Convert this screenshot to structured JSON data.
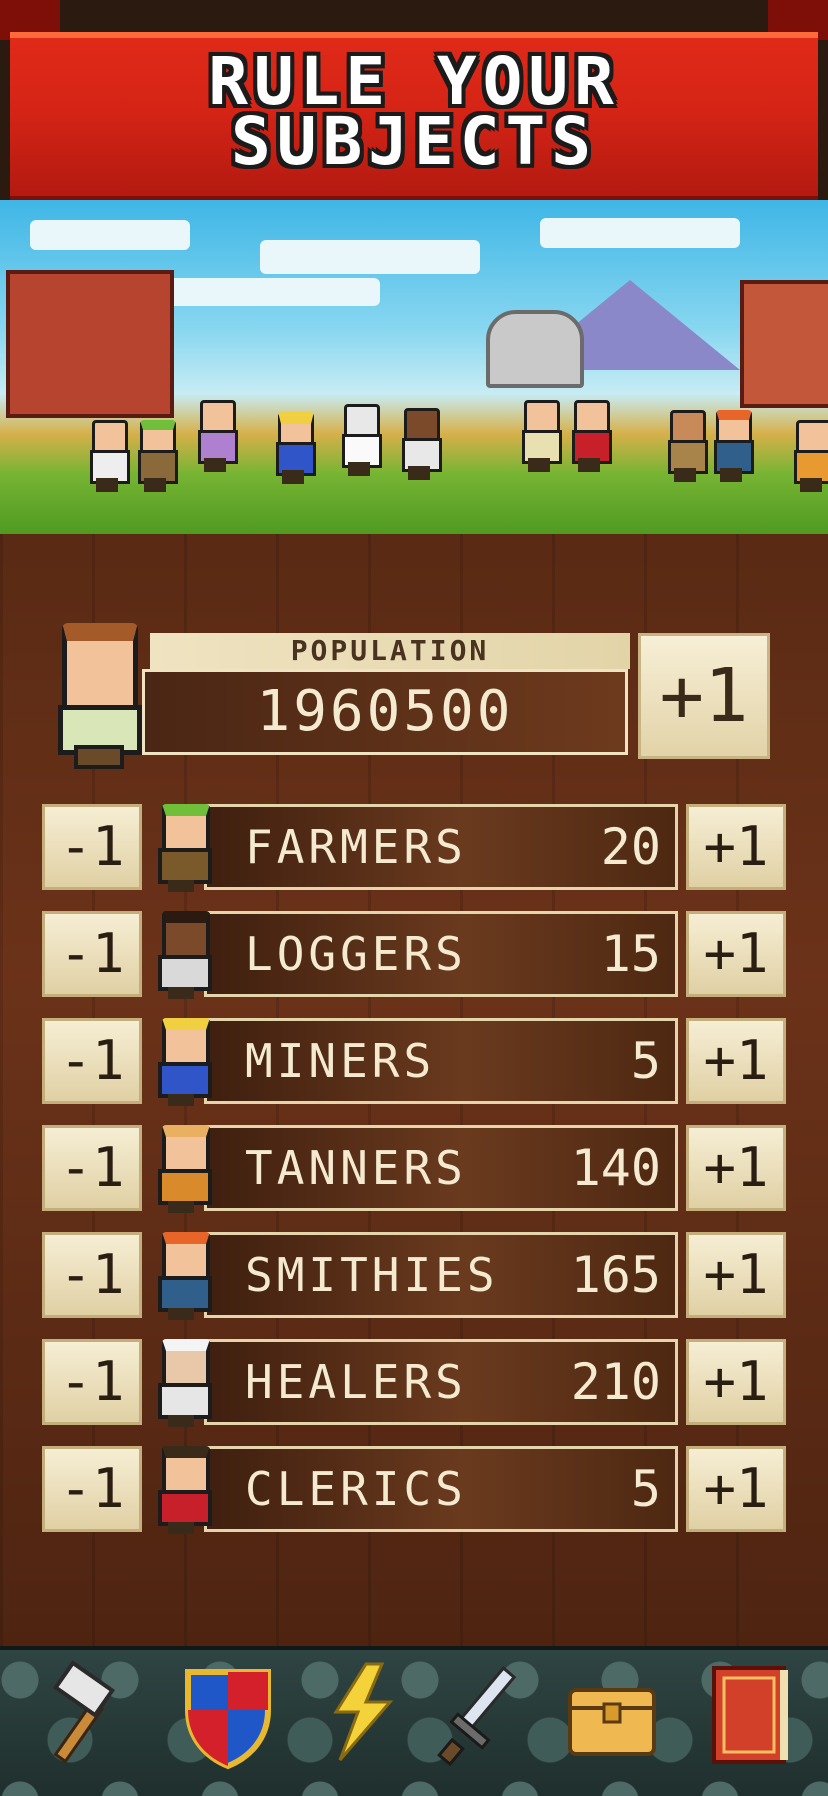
{
  "banner": {
    "line1": "RULE YOUR",
    "line2": "SUBJECTS"
  },
  "population": {
    "label": "POPULATION",
    "value": "1960500",
    "add_label": "+1"
  },
  "professions": [
    {
      "name": "FARMERS",
      "count": "20",
      "minus": "-1",
      "plus": "+1",
      "hat": "#6fbf3a",
      "skin": "#f2c39a",
      "shirt": "#7a5a2a"
    },
    {
      "name": "LOGGERS",
      "count": "15",
      "minus": "-1",
      "plus": "+1",
      "hat": "#2a1a10",
      "skin": "#7a4a2a",
      "shirt": "#d9d9d9"
    },
    {
      "name": "MINERS",
      "count": "5",
      "minus": "-1",
      "plus": "+1",
      "hat": "#f0d040",
      "skin": "#f2c39a",
      "shirt": "#2f55c8"
    },
    {
      "name": "TANNERS",
      "count": "140",
      "minus": "-1",
      "plus": "+1",
      "hat": "#e8b060",
      "skin": "#f2c39a",
      "shirt": "#d98a2a"
    },
    {
      "name": "SMITHIES",
      "count": "165",
      "minus": "-1",
      "plus": "+1",
      "hat": "#e8652a",
      "skin": "#f2c39a",
      "shirt": "#2f5f8a"
    },
    {
      "name": "HEALERS",
      "count": "210",
      "minus": "-1",
      "plus": "+1",
      "hat": "#f4f4f4",
      "skin": "#e8c8a8",
      "shirt": "#e6e6e6"
    },
    {
      "name": "CLERICS",
      "count": "5",
      "minus": "-1",
      "plus": "+1",
      "hat": "#3a2a1a",
      "skin": "#f2c39a",
      "shirt": "#c8202a"
    }
  ],
  "toolbar": {
    "items": [
      "hammer-icon",
      "shield-icon",
      "lightning-icon",
      "sword-icon",
      "chest-icon",
      "book-icon"
    ]
  }
}
